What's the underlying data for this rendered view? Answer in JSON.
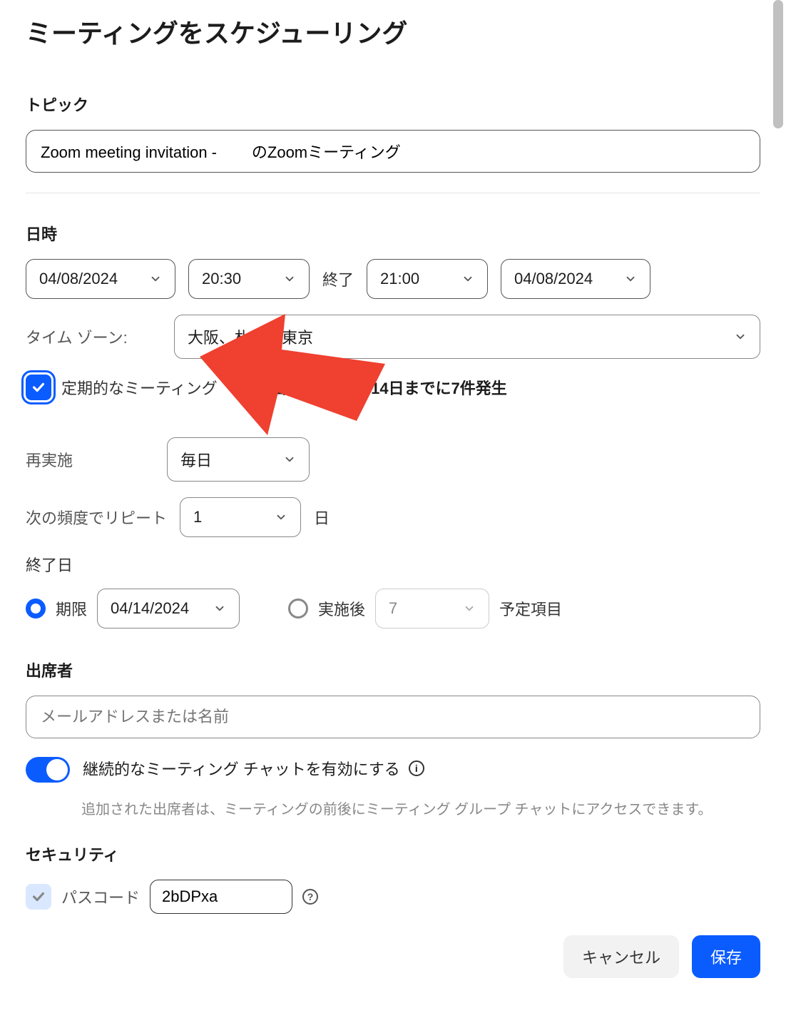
{
  "title": "ミーティングをスケジューリング",
  "topic": {
    "label": "トピック",
    "value": "Zoom meeting invitation -        のZoomミーティング"
  },
  "datetime": {
    "label": "日時",
    "start_date": "04/08/2024",
    "start_time": "20:30",
    "end_label": "終了",
    "end_time": "21:00",
    "end_date": "04/08/2024"
  },
  "timezone": {
    "label": "タイム ゾーン:",
    "value": "大阪、札幌、東京"
  },
  "recurring": {
    "checkbox_label": "定期的なミーティング",
    "summary": "毎日, 2024年4月14日までに7件発生"
  },
  "repeat": {
    "label": "再実施",
    "value": "毎日"
  },
  "frequency": {
    "label": "次の頻度でリピート",
    "value": "1",
    "unit": "日"
  },
  "end": {
    "label": "終了日",
    "by_date_label": "期限",
    "by_date_value": "04/14/2024",
    "after_label": "実施後",
    "occurrences_value": "7",
    "occurrences_unit": "予定項目"
  },
  "attendees": {
    "label": "出席者",
    "placeholder": "メールアドレスまたは名前"
  },
  "chat": {
    "label": "継続的なミーティング チャットを有効にする",
    "description": "追加された出席者は、ミーティングの前後にミーティング グループ チャットにアクセスできます。"
  },
  "security": {
    "label": "セキュリティ",
    "passcode_label": "パスコード",
    "passcode_value": "2bDPxa"
  },
  "buttons": {
    "cancel": "キャンセル",
    "save": "保存"
  }
}
